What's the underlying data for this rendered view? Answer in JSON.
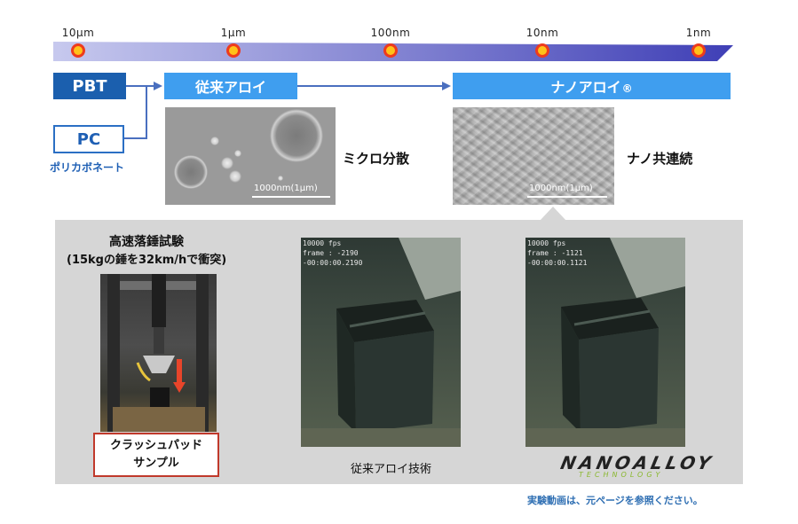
{
  "scale_bar": {
    "labels": [
      "10μm",
      "1μm",
      "100nm",
      "10nm",
      "1nm"
    ]
  },
  "materials": {
    "pbt": "PBT",
    "pc": "PC",
    "pc_subtitle": "ポリカボネート",
    "conventional": "従来アロイ",
    "nano": "ナノアロイ",
    "nano_mark": "®"
  },
  "micrographs": {
    "conventional_scale": "1000nm(1μm)",
    "conventional_label": "ミクロ分散",
    "nano_scale": "1000nm(1μm)",
    "nano_label": "ナノ共連続"
  },
  "experiment": {
    "title": "高速落錘試験",
    "subtitle": "(15kgの錘を32km/hで衝突)",
    "sample_label_line1": "クラッシュパッド",
    "sample_label_line2": "サンプル",
    "video1_overlay": "10000 fps\nframe : -2190\n-00:00:00.2190",
    "video2_overlay": "10000 fps\nframe : -1121\n-00:00:00.1121",
    "video1_caption": "従来アロイ技術",
    "logo_text": "NANOALLOY",
    "logo_sub": "TECHNOLOGY"
  },
  "footer_note": "実験動画は、元ページを参照ください。",
  "colors": {
    "light_blue": "#3f9eef",
    "navy": "#1b5fae",
    "dot_fill": "#ffc21a",
    "dot_ring": "#ee3b1d",
    "panel_gray": "#d6d6d6"
  }
}
